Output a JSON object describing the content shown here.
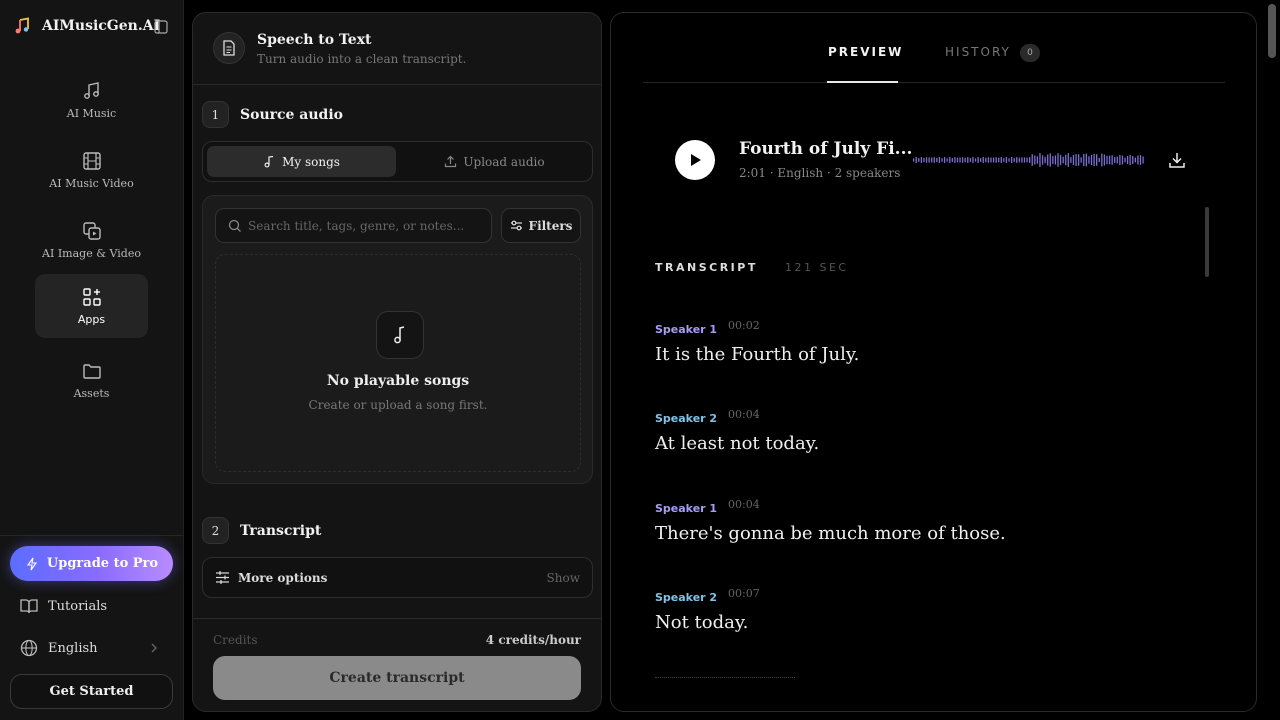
{
  "brand": {
    "name": "AIMusicGen.AI"
  },
  "nav": [
    {
      "label": "AI Music",
      "icon": "music-notes-icon"
    },
    {
      "label": "AI Music Video",
      "icon": "film-icon"
    },
    {
      "label": "AI Image & Video",
      "icon": "image-video-icon"
    },
    {
      "label": "Apps",
      "icon": "apps-grid-icon",
      "active": true
    },
    {
      "label": "Assets",
      "icon": "folder-icon"
    }
  ],
  "sidebar_bottom": {
    "upgrade": "Upgrade to Pro",
    "tutorials": "Tutorials",
    "language": "English",
    "get_started": "Get Started"
  },
  "tool": {
    "title": "Speech to Text",
    "subtitle": "Turn audio into a clean transcript."
  },
  "step1": {
    "number": "1",
    "label": "Source audio",
    "tabs": [
      "My songs",
      "Upload audio"
    ],
    "search_placeholder": "Search title, tags, genre, or notes...",
    "filters": "Filters",
    "empty_title": "No playable songs",
    "empty_text": "Create or upload a song first."
  },
  "step2": {
    "number": "2",
    "label": "Transcript",
    "more_options": "More options",
    "show": "Show"
  },
  "footer": {
    "credits_label": "Credits",
    "credits_value": "4 credits/hour",
    "create": "Create transcript"
  },
  "preview": {
    "tab_preview": "PREVIEW",
    "tab_history": "HISTORY",
    "history_count": "0",
    "track_title": "Fourth of July Fi...",
    "track_meta": "2:01 · English · 2 speakers",
    "transcript_label": "TRANSCRIPT",
    "transcript_seconds": "121 SEC",
    "segments": [
      {
        "speaker": "Speaker 1",
        "time": "00:02",
        "text": "It is the Fourth of July."
      },
      {
        "speaker": "Speaker 2",
        "time": "00:04",
        "text": "At least not today."
      },
      {
        "speaker": "Speaker 1",
        "time": "00:04",
        "text": "There's gonna be much more of those."
      },
      {
        "speaker": "Speaker 2",
        "time": "00:07",
        "text": "Not today."
      }
    ]
  },
  "colors": {
    "speaker1": "#a99cf5",
    "speaker2": "#7fc3e8",
    "accent_gradient_start": "#5b6dff",
    "accent_gradient_end": "#b98cff"
  }
}
